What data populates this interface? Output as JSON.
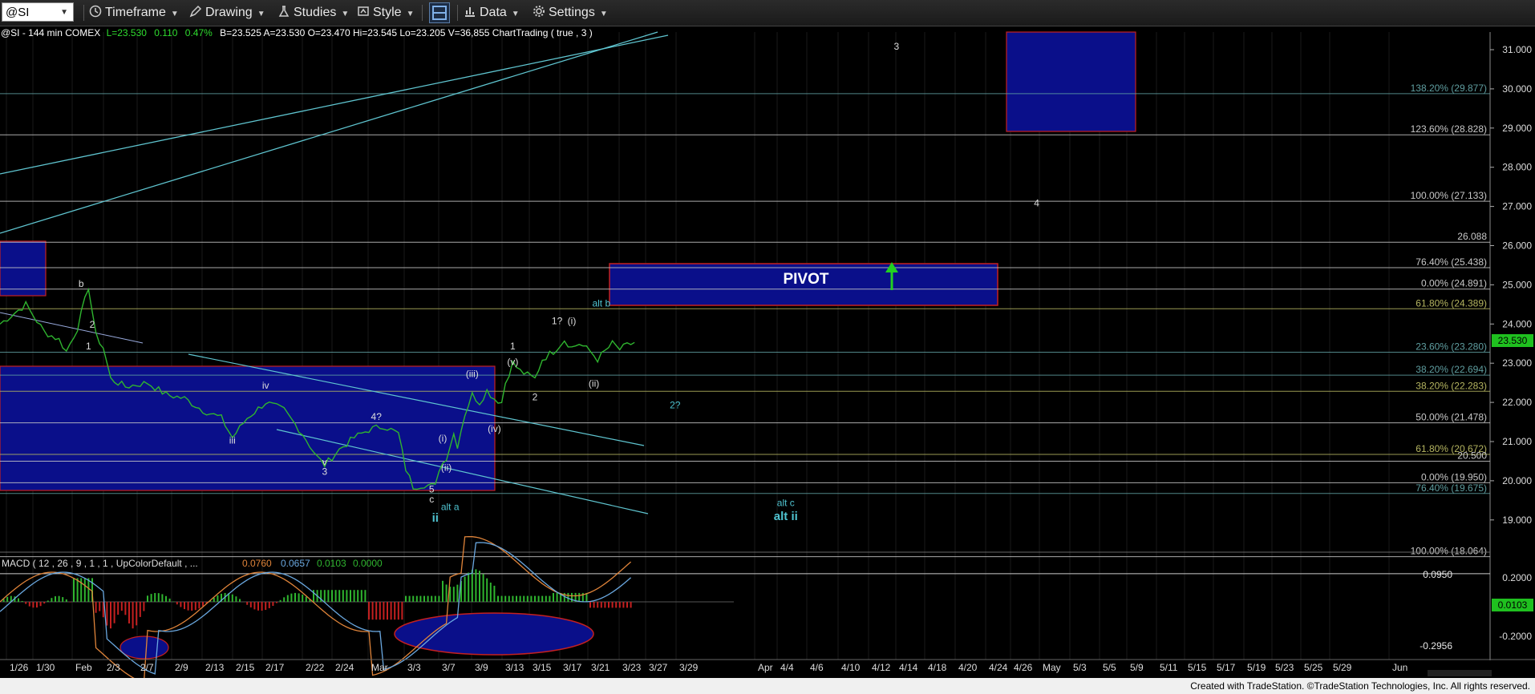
{
  "toolbar": {
    "symbol": "@SI",
    "timeframe": "Timeframe",
    "drawing": "Drawing",
    "studies": "Studies",
    "style": "Style",
    "data": "Data",
    "settings": "Settings"
  },
  "header": {
    "text": "@SI - 144 min COMEX",
    "last": "L=23.530",
    "change": "0.110",
    "change_pct": "0.47%",
    "rest": "B=23.525  A=23.530  O=23.470  Hi=23.545  Lo=23.205  V=36,855  ChartTrading ( true , 3 )"
  },
  "macd": {
    "label": "MACD ( 12 , 26 , 9 , 1 , 1 , UpColorDefault , ...",
    "v1": "0.0760",
    "v2": "0.0657",
    "v3": "0.0103",
    "v4": "0.0000",
    "scale_top": "0.2000",
    "scale_bottom": "-0.2000",
    "level_high": "0.0950",
    "level_low": "-0.2956",
    "current": "0.0103",
    "level_high_value": 0.095,
    "level_low_value": -0.2956
  },
  "footer": "Created with TradeStation. ©TradeStation Technologies, Inc. All rights reserved.",
  "pivot_label": "PIVOT",
  "price_current_label": "23.530",
  "chart_data": {
    "type": "line",
    "ylim": [
      18.0,
      31.3
    ],
    "y_ticks": [
      "19.000",
      "20.000",
      "21.000",
      "22.000",
      "23.000",
      "24.000",
      "25.000",
      "26.000",
      "27.000",
      "28.000",
      "29.000",
      "30.000",
      "31.000"
    ],
    "x_labels": [
      "1/26",
      "1/30",
      "Feb",
      "2/3",
      "2/7",
      "2/9",
      "2/13",
      "2/15",
      "2/17",
      "2/22",
      "2/24",
      "Mar",
      "3/3",
      "3/7",
      "3/9",
      "3/13",
      "3/15",
      "3/17",
      "3/21",
      "3/23",
      "3/27",
      "3/29",
      "Apr",
      "4/4",
      "4/6",
      "4/10",
      "4/12",
      "4/14",
      "4/18",
      "4/20",
      "4/24",
      "4/26",
      "May",
      "5/3",
      "5/5",
      "5/9",
      "5/11",
      "5/15",
      "5/17",
      "5/19",
      "5/23",
      "5/25",
      "5/29",
      "Jun"
    ],
    "fib_levels": [
      {
        "label": "138.20% (29.877)",
        "value": 29.877,
        "color": "#5f9ea0"
      },
      {
        "label": "123.60% (28.828)",
        "value": 28.828,
        "color": "#c8c8c8"
      },
      {
        "label": "100.00% (27.133)",
        "value": 27.133,
        "color": "#c8c8c8"
      },
      {
        "label": "26.088",
        "value": 26.088,
        "color": "#c8c8c8"
      },
      {
        "label": "76.40% (25.438)",
        "value": 25.438,
        "color": "#c8c8c8"
      },
      {
        "label": "0.00% (24.891)",
        "value": 24.891,
        "color": "#c8c8c8"
      },
      {
        "label": "61.80% (24.389)",
        "value": 24.389,
        "color": "#b5b560"
      },
      {
        "label": "23.60% (23.280)",
        "value": 23.28,
        "color": "#5f9ea0"
      },
      {
        "label": "38.20% (22.694)",
        "value": 22.694,
        "color": "#5f9ea0"
      },
      {
        "label": "38.20% (22.283)",
        "value": 22.283,
        "color": "#b5b560"
      },
      {
        "label": "50.00% (21.478)",
        "value": 21.478,
        "color": "#c8c8c8"
      },
      {
        "label": "61.80% (20.672)",
        "value": 20.672,
        "color": "#b5b560"
      },
      {
        "label": "20.500",
        "value": 20.5,
        "color": "#c8c8c8"
      },
      {
        "label": "0.00% (19.950)",
        "value": 19.95,
        "color": "#c8c8c8"
      },
      {
        "label": "76.40% (19.675)",
        "value": 19.675,
        "color": "#5f9ea0"
      },
      {
        "label": "100.00% (18.064)",
        "value": 18.064,
        "color": "#c8c8c8"
      }
    ],
    "labels": [
      {
        "text": "b",
        "x": 22,
        "y": 24.95,
        "color": "#ddd"
      },
      {
        "text": "2",
        "x": 25,
        "y": 23.9,
        "color": "#ddd"
      },
      {
        "text": "1",
        "x": 24,
        "y": 23.35,
        "color": "#ddd"
      },
      {
        "text": "iv",
        "x": 72,
        "y": 22.35,
        "color": "#ddd"
      },
      {
        "text": "iii",
        "x": 63,
        "y": 20.95,
        "color": "#ddd"
      },
      {
        "text": "4?",
        "x": 102,
        "y": 21.55,
        "color": "#ddd"
      },
      {
        "text": "v",
        "x": 88,
        "y": 20.4,
        "color": "#ddd"
      },
      {
        "text": "3",
        "x": 88,
        "y": 20.15,
        "color": "#ddd"
      },
      {
        "text": "(i)",
        "x": 120,
        "y": 21.0,
        "color": "#ddd"
      },
      {
        "text": "(ii)",
        "x": 121,
        "y": 20.25,
        "color": "#ddd"
      },
      {
        "text": "(iii)",
        "x": 128,
        "y": 22.65,
        "color": "#ddd"
      },
      {
        "text": "(iv)",
        "x": 134,
        "y": 21.25,
        "color": "#ddd"
      },
      {
        "text": "(v)",
        "x": 139,
        "y": 22.95,
        "color": "#ddd"
      },
      {
        "text": "1",
        "x": 139,
        "y": 23.35,
        "color": "#ddd"
      },
      {
        "text": "2",
        "x": 145,
        "y": 22.05,
        "color": "#ddd"
      },
      {
        "text": "1?",
        "x": 151,
        "y": 24.0,
        "color": "#ddd"
      },
      {
        "text": "(i)",
        "x": 155,
        "y": 24.0,
        "color": "#ddd"
      },
      {
        "text": "(ii)",
        "x": 161,
        "y": 22.4,
        "color": "#ddd"
      },
      {
        "text": "alt b",
        "x": 163,
        "y": 24.45,
        "color": "#4fc3d0"
      },
      {
        "text": "2?",
        "x": 183,
        "y": 21.85,
        "color": "#4fc3d0"
      },
      {
        "text": "5",
        "x": 117,
        "y": 19.7,
        "color": "#ddd"
      },
      {
        "text": "c",
        "x": 117,
        "y": 19.45,
        "color": "#ddd"
      },
      {
        "text": "alt a",
        "x": 122,
        "y": 19.25,
        "color": "#4fc3d0"
      },
      {
        "text": "ii",
        "x": 118,
        "y": 18.95,
        "color": "#4fc3d0"
      },
      {
        "text": "alt c",
        "x": 213,
        "y": 19.35,
        "color": "#4fc3d0"
      },
      {
        "text": "alt ii",
        "x": 213,
        "y": 19.0,
        "color": "#4fc3d0"
      },
      {
        "text": "3",
        "x": 243,
        "y": 31.0,
        "color": "#ddd"
      },
      {
        "text": "4",
        "x": 281,
        "y": 27.0,
        "color": "#ddd"
      }
    ]
  }
}
